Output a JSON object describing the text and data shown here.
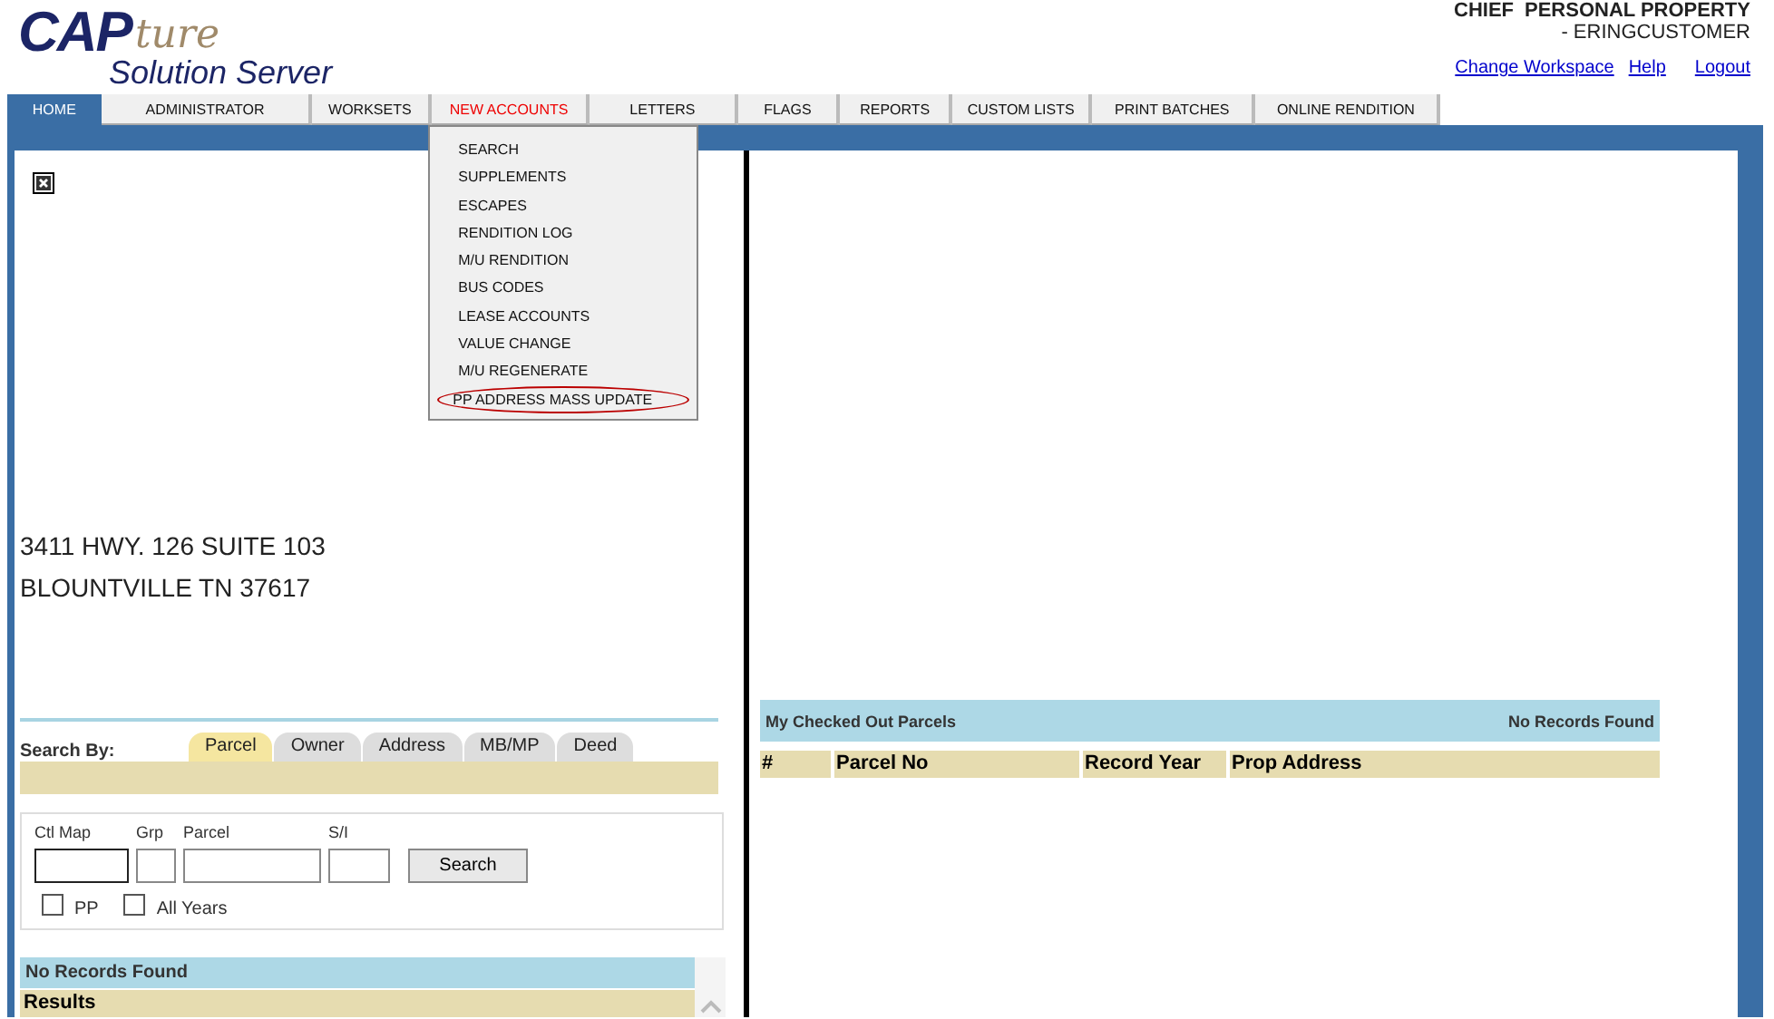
{
  "logo": {
    "main": "CAP",
    "script": "ture",
    "subtitle": "Solution Server"
  },
  "user": {
    "role": "CHIEF",
    "office": "PERSONAL PROPERTY",
    "name": "-  ERINGCUSTOMER"
  },
  "links": [
    "Change Workspace",
    "Help",
    "Logout"
  ],
  "nav": [
    {
      "label": "HOME",
      "selected": true,
      "open": false
    },
    {
      "label": "ADMINISTRATOR",
      "selected": false,
      "open": false
    },
    {
      "label": "WORKSETS",
      "selected": false,
      "open": false
    },
    {
      "label": "NEW ACCOUNTS",
      "selected": false,
      "open": true
    },
    {
      "label": "LETTERS",
      "selected": false,
      "open": false
    },
    {
      "label": "FLAGS",
      "selected": false,
      "open": false
    },
    {
      "label": "REPORTS",
      "selected": false,
      "open": false
    },
    {
      "label": "CUSTOM LISTS",
      "selected": false,
      "open": false
    },
    {
      "label": "PRINT BATCHES",
      "selected": false,
      "open": false
    },
    {
      "label": "ONLINE RENDITION",
      "selected": false,
      "open": false
    }
  ],
  "menu": [
    {
      "label": "SEARCH",
      "circled": false
    },
    {
      "label": "SUPPLEMENTS",
      "circled": false
    },
    {
      "label": "ESCAPES",
      "circled": false
    },
    {
      "label": "RENDITION LOG",
      "circled": false
    },
    {
      "label": "M/U RENDITION",
      "circled": false
    },
    {
      "label": "BUS CODES",
      "circled": false
    },
    {
      "label": "LEASE ACCOUNTS",
      "circled": false
    },
    {
      "label": "VALUE CHANGE",
      "circled": false
    },
    {
      "label": "M/U REGENERATE",
      "circled": false
    },
    {
      "label": "PP ADDRESS MASS UPDATE",
      "circled": true
    }
  ],
  "address": [
    "3411 HWY. 126 SUITE 103",
    "BLOUNTVILLE TN 37617"
  ],
  "search": {
    "label": "Search By:",
    "tabs": [
      {
        "label": "Parcel",
        "selected": true
      },
      {
        "label": "Owner",
        "selected": false
      },
      {
        "label": "Address",
        "selected": false
      },
      {
        "label": "MB/MP",
        "selected": false
      },
      {
        "label": "Deed",
        "selected": false
      }
    ],
    "fields": [
      {
        "label": "Ctl Map",
        "focused": true
      },
      {
        "label": "Grp",
        "focused": false
      },
      {
        "label": "Parcel",
        "focused": false
      },
      {
        "label": "S/I",
        "focused": false
      }
    ],
    "button": "Search",
    "checkboxes": [
      {
        "label": "PP",
        "checked": false
      },
      {
        "label": "All Years",
        "checked": false
      }
    ]
  },
  "results": {
    "status": "No Records Found",
    "title": "Results"
  },
  "checked_out": {
    "title": "My Checked Out Parcels",
    "status": "No Records Found",
    "columns": [
      "#",
      "Parcel No",
      "Record Year",
      "Prop Address"
    ]
  }
}
